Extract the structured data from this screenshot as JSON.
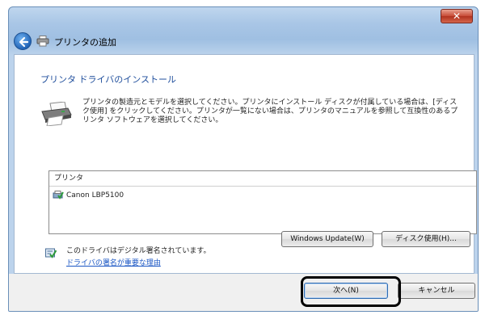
{
  "window": {
    "close_symbol": "✕"
  },
  "nav": {
    "title": "プリンタの追加"
  },
  "content": {
    "heading": "プリンタ ドライバのインストール",
    "description": "プリンタの製造元とモデルを選択してください。プリンタにインストール ディスクが付属している場合は、[ディスク使用] をクリックしてください。プリンタが一覧にない場合は、プリンタのマニュアルを参照して互換性のあるプリンタ ソフトウェアを選択してください。"
  },
  "printer_list": {
    "header": "プリンタ",
    "items": [
      {
        "label": "Canon LBP5100"
      }
    ]
  },
  "signature": {
    "text": "このドライバはデジタル署名されています。",
    "link": "ドライバの署名が重要な理由"
  },
  "buttons": {
    "windows_update": "Windows Update(W)",
    "have_disk": "ディスク使用(H)...",
    "next": "次へ(N)",
    "cancel": "キャンセル"
  },
  "colors": {
    "heading": "#1f4e9c",
    "link": "#1a56c4"
  }
}
